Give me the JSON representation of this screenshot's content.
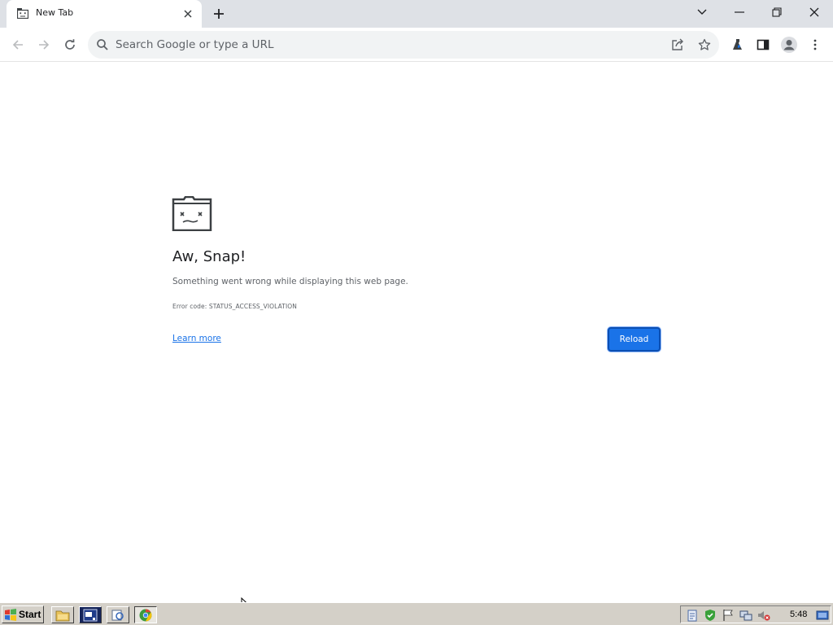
{
  "browser": {
    "tab": {
      "title": "New Tab"
    },
    "omnibox": {
      "placeholder": "Search Google or type a URL"
    }
  },
  "sad_tab": {
    "title": "Aw, Snap!",
    "message": "Something went wrong while displaying this web page.",
    "error_code": "Error code: STATUS_ACCESS_VIOLATION",
    "learn_more": "Learn more",
    "reload": "Reload"
  },
  "taskbar": {
    "start_label": "Start",
    "clock": "5:48"
  },
  "colors": {
    "accent": "#1a73e8",
    "tabstrip": "#dee1e6",
    "taskbar": "#d4d0c8"
  },
  "icons": [
    "sad-tab-icon",
    "close-icon",
    "plus-icon",
    "chevron-down-icon",
    "minimize-icon",
    "restore-icon",
    "window-close-icon",
    "back-icon",
    "forward-icon",
    "reload-icon",
    "search-icon",
    "share-icon",
    "star-icon",
    "extensions-icon",
    "side-panel-icon",
    "profile-icon",
    "menu-icon"
  ]
}
